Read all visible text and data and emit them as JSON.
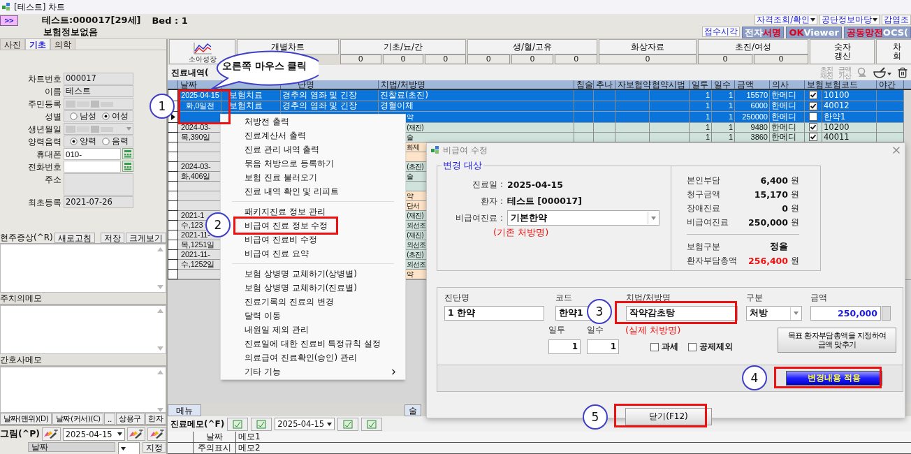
{
  "window": {
    "title": "[테스트] 차트"
  },
  "header": {
    "expand_button": ">>",
    "patient": "테스트:000017[29세]",
    "bed": "Bed : 1",
    "insurance": "보험정보없음",
    "links": [
      {
        "label": "자격조회/확인",
        "dropdown": true
      },
      {
        "label": "공단정보마당",
        "dropdown": true
      },
      {
        "label": "감염조",
        "dropdown": false
      }
    ],
    "reception_link": "접수시각",
    "badges": [
      {
        "parts": [
          {
            "text": "전자",
            "highlight": false
          },
          {
            "text": "서명",
            "highlight": true
          }
        ]
      },
      {
        "parts": [
          {
            "text": "OK",
            "highlight": true
          },
          {
            "text": " Viewer",
            "highlight": false
          }
        ]
      },
      {
        "parts": [
          {
            "text": "공동망전",
            "highlight": true
          },
          {
            "text": "OCS(",
            "highlight": false
          }
        ]
      }
    ]
  },
  "left_tabs": [
    {
      "label": "사진",
      "selected": false
    },
    {
      "label": "기초",
      "selected": true
    },
    {
      "label": "의학",
      "selected": false
    }
  ],
  "fields": [
    {
      "label": "차트번호",
      "kind": "text",
      "value": "000017"
    },
    {
      "label": "이름",
      "kind": "text",
      "value": "테스트"
    },
    {
      "label": "주민등록",
      "kind": "blurred"
    },
    {
      "label": "성별",
      "kind": "radio",
      "options": [
        {
          "label": "남성",
          "selected": false
        },
        {
          "label": "여성",
          "selected": true
        }
      ]
    },
    {
      "label": "생년월일",
      "kind": "blurred-select"
    },
    {
      "label": "양력음력",
      "kind": "radio",
      "options": [
        {
          "label": "양력",
          "selected": true
        },
        {
          "label": "음력",
          "selected": false
        }
      ]
    },
    {
      "label": "휴대폰",
      "kind": "phone",
      "value": "010-"
    },
    {
      "label": "전화번호",
      "kind": "phone"
    },
    {
      "label": "주소",
      "kind": "area"
    },
    {
      "label": "최초등록",
      "kind": "text",
      "value": "2021-07-26"
    }
  ],
  "symptom_bar": {
    "title": "현주증상(^R)",
    "refresh": "새로고침",
    "save": "저장",
    "enlarge": "크게보기"
  },
  "memos": [
    {
      "title": "주치의메모"
    },
    {
      "title": "간호사메모"
    }
  ],
  "left_buttons": [
    "날짜(맨위)(D)",
    "날짜(커서)(C)",
    "..",
    "상용구",
    "한자"
  ],
  "drawing_bar": {
    "title": "그림(^P)",
    "date": "2025-04-15"
  },
  "drawing_table": {
    "column": "날짜",
    "action": "지정"
  },
  "chart_tabs": [
    {
      "kind": "icon",
      "label": "소아성장"
    },
    {
      "kind": "group",
      "label": "개별차트"
    },
    {
      "kind": "group",
      "label": "기초/뇨/간",
      "counts": [
        "0",
        "0",
        "0"
      ]
    },
    {
      "kind": "group",
      "label": "생/혈/고유",
      "counts": [
        "0",
        "0",
        "0"
      ]
    },
    {
      "kind": "group",
      "label": "화상자료",
      "counts": [
        "0"
      ]
    },
    {
      "kind": "group",
      "label": "초진/여성",
      "counts": [
        "0",
        "0"
      ]
    },
    {
      "kind": "button",
      "label": "숫자\n갱신"
    },
    {
      "kind": "button",
      "label": "차\n회"
    }
  ],
  "records": {
    "title": "진료내역(",
    "toolbar": [
      {
        "kind": "text",
        "label": "초진\n재진"
      },
      {
        "kind": "text",
        "label": "금액\n가산"
      },
      {
        "kind": "stamp"
      },
      {
        "kind": "mortar"
      },
      {
        "kind": "trash"
      }
    ],
    "columns": [
      {
        "label": "날짜"
      },
      {},
      {
        "label": "단명"
      },
      {
        "label": "치법/처방명"
      },
      {
        "label": "침술"
      },
      {
        "label": "추나"
      },
      {
        "label": "자보협약"
      },
      {
        "label": "협약시범"
      },
      {
        "label": "일투"
      },
      {
        "label": "일수"
      },
      {
        "label": "금액"
      },
      {
        "label": "의사"
      },
      {
        "label": "보험"
      },
      {
        "label": "보험코드"
      },
      {
        "label": "야간"
      }
    ],
    "rows": [
      {
        "selected": true,
        "date": "2025-04-15",
        "type": "보험치료",
        "diagnosis": "경추의 염좌 및 긴장",
        "treatment": "진찰료(초진)",
        "daily": "1",
        "days": "1",
        "amount": "15570",
        "doctor": "한메디",
        "insured": true,
        "code": "10100"
      },
      {
        "selected": true,
        "date": "화,0일전",
        "type": "보험치료",
        "diagnosis": "경추의 염좌 및 긴장",
        "treatment": "경혈이체",
        "daily": "1",
        "days": "1",
        "amount": "6000",
        "doctor": "한메디",
        "insured": true,
        "code": "40012"
      },
      {
        "selected": true,
        "pointer": true,
        "treatment_tail": "약",
        "daily": "1",
        "days": "1",
        "amount": "250000",
        "doctor": "한메디",
        "insured": false,
        "code": "한약1"
      },
      {
        "selected": false,
        "color": "#cfe3dc",
        "date": "2024-03-",
        "treatment_tail": "(재진)",
        "daily": "1",
        "days": "1",
        "amount": "9480",
        "doctor": "한메디",
        "insured": true,
        "code": "10200"
      },
      {
        "selected": false,
        "color": "#cfe3dc",
        "date": "목,390일",
        "treatment_tail": "술",
        "daily": "1",
        "days": "1",
        "amount": "3860",
        "doctor": "한메디",
        "insured": true,
        "code": "40011"
      },
      {
        "selected": false,
        "color": "#fde3c8",
        "treatment_tail": "화제"
      },
      {
        "selected": false,
        "color": "#fde3c8"
      },
      {
        "selected": false,
        "color": "#cfe3dc",
        "date": "2024-03-",
        "treatment_tail": "(초진)"
      },
      {
        "selected": false,
        "color": "#cfe3dc",
        "date": "화,406일",
        "treatment_tail": "술"
      },
      {
        "selected": false,
        "color": "#cfe3dc"
      },
      {
        "selected": false,
        "color": "#fde3c8",
        "treatment_tail": "약"
      },
      {
        "selected": false,
        "color": "#fde3c8",
        "treatment_tail": "단서"
      },
      {
        "selected": false,
        "color": "#cfe3dc",
        "date": "2021-1",
        "treatment_tail": "(재진)"
      },
      {
        "selected": false,
        "color": "#cfe3dc",
        "date": "수,123",
        "treatment_tail": "외선조"
      },
      {
        "selected": false,
        "color": "#cfe3dc",
        "date": "2021-11-",
        "treatment_tail": "(재진)"
      },
      {
        "selected": false,
        "color": "#cfe3dc",
        "date": "목,1251일",
        "treatment_tail": "외선조"
      },
      {
        "selected": false,
        "color": "#cfe3dc",
        "date": "2021-11-",
        "treatment_tail": "(초진)"
      },
      {
        "selected": false,
        "color": "#cfe3dc",
        "date": "수,1252일",
        "treatment_tail": "외선조"
      },
      {
        "selected": false,
        "color": "#fde3c8",
        "treatment_tail": "약"
      }
    ]
  },
  "bottom_tabs": [
    {
      "label": "메뉴",
      "kind": "tab"
    },
    {
      "label": "술",
      "kind": "tail"
    }
  ],
  "memo": {
    "title": "진료메모(^F)",
    "date": "2025-04-15",
    "rows": [
      {
        "label": "날짜",
        "value": "메모1"
      },
      {
        "label": "주의표시",
        "value": "메모2"
      }
    ]
  },
  "context_menu": {
    "groups": [
      [
        {
          "label": "처방전 출력"
        },
        {
          "label": "진료계산서 출력"
        },
        {
          "label": "진료 관리 내역 출력"
        },
        {
          "label": "묶음 처방으로 등록하기"
        },
        {
          "label": "보험 진료 불러오기"
        },
        {
          "label": "진료 내역 확인 및 리피트"
        }
      ],
      [
        {
          "label": "패키지진료 정보 관리"
        },
        {
          "label": "비급여 진료 정보 수정"
        },
        {
          "label": "비급여 진료비 수정"
        },
        {
          "label": "비급여 진료 요약"
        }
      ],
      [
        {
          "label": "보험 상병명 교체하기(상병별)"
        },
        {
          "label": "보험 상병명 교체하기(진료별)"
        },
        {
          "label": "진료기록의 진료의 변경"
        },
        {
          "label": "달력 이동"
        },
        {
          "label": "내원일 제외 관리"
        },
        {
          "label": "진료일에 대한 진료비 특정규칙 설정"
        },
        {
          "label": "의료급여 진료확인(승인) 관리"
        },
        {
          "label": "기타 기능",
          "submenu": true
        }
      ]
    ]
  },
  "dialog": {
    "title": "비급여 수정",
    "group_title": "변경 대상",
    "info": [
      {
        "label": "진료일 :",
        "value": "2025-04-15"
      },
      {
        "label": "환자 :",
        "value": "테스트 [000017]"
      }
    ],
    "select": {
      "label": "비급여진료 :",
      "value": "기본한약"
    },
    "select_note": "(기존 처방명)",
    "summary": [
      [
        {
          "label": "본인부담",
          "value": "6,400",
          "unit": "원"
        },
        {
          "label": "청구금액",
          "value": "15,170",
          "unit": "원"
        },
        {
          "label": "장애진료",
          "value": "0",
          "unit": "원"
        },
        {
          "label": "비급여진료",
          "value": "250,000",
          "unit": "원"
        }
      ],
      [
        {
          "label": "보험구분",
          "value": "정율"
        },
        {
          "label": "환자부담총액",
          "value": "256,400",
          "unit": "원",
          "highlight": true
        }
      ]
    ],
    "fields": [
      {
        "label": "진단명",
        "value": "1 한약",
        "kind": "text"
      },
      {
        "label": "코드",
        "value": "한약1",
        "kind": "text"
      },
      {
        "label": "치법/처방명",
        "value": "작약감초탕",
        "kind": "text"
      },
      {
        "label": "구분",
        "value": "처방",
        "kind": "select"
      },
      {
        "label": "금액",
        "value": "250,000",
        "kind": "amount"
      }
    ],
    "counts": [
      {
        "label": "일투",
        "value": "1"
      },
      {
        "label": "일수",
        "value": "1"
      }
    ],
    "field_note": "(실제 처방명)",
    "checks": [
      {
        "label": "과세",
        "checked": false
      },
      {
        "label": "공제제외",
        "checked": false
      }
    ],
    "target_button": "목표 환자부담총액을 지정하여\n금액 맞추기",
    "apply_button": "변경내용 적용",
    "close_button": "닫기(F12)"
  },
  "annotations": {
    "callout": "오른쪽 마우스 클릭",
    "steps": [
      "1",
      "2",
      "3",
      "4",
      "5"
    ]
  }
}
